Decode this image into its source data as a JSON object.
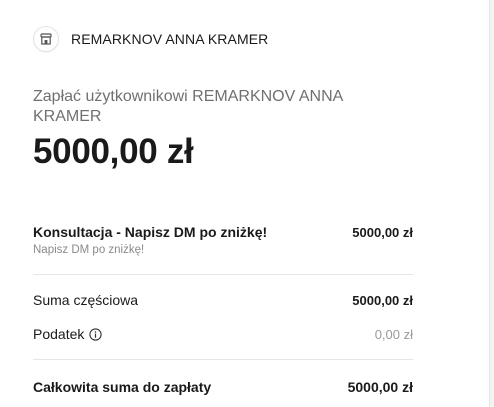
{
  "merchant": {
    "icon": "store-icon",
    "name": "REMARKNOV ANNA KRAMER"
  },
  "summary": {
    "pay_label": "Zapłać użytkownikowi REMARKNOV ANNA KRAMER",
    "amount": "5000,00 zł"
  },
  "line_items": [
    {
      "name": "Konsultacja - Napisz DM po zniżkę!",
      "description": "Napisz DM po zniżkę!",
      "price": "5000,00 zł"
    }
  ],
  "totals": {
    "subtotal_label": "Suma częściowa",
    "subtotal_value": "5000,00 zł",
    "tax_label": "Podatek",
    "tax_icon": "info-icon",
    "tax_value": "0,00 zł",
    "total_label": "Całkowita suma do zapłaty",
    "total_value": "5000,00 zł"
  }
}
